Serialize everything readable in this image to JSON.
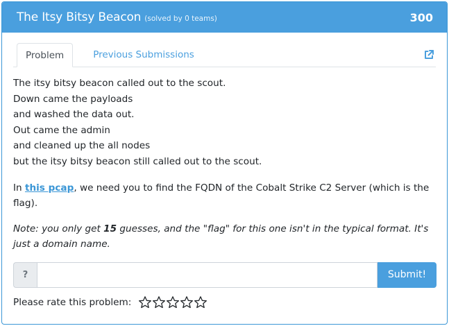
{
  "header": {
    "title": "The Itsy Bitsy Beacon",
    "solved": "(solved by 0 teams)",
    "points": "300"
  },
  "tabs": [
    {
      "label": "Problem",
      "active": true
    },
    {
      "label": "Previous Submissions",
      "active": false
    }
  ],
  "external_icon": "external-link-icon",
  "description": {
    "lines": [
      "The itsy bitsy beacon called out to the scout.",
      "Down came the payloads",
      "and washed the data out.",
      "Out came the admin",
      "and cleaned up the all nodes",
      "but the itsy bitsy beacon still called out to the scout."
    ],
    "paragraph_prefix": "In ",
    "link_text": "this pcap",
    "paragraph_suffix": ", we need you to find the FQDN of the Cobalt Strike C2 Server (which is the flag).",
    "note_prefix": "Note: you only get ",
    "note_count": "15",
    "note_suffix": " guesses, and the \"flag\" for this one isn't in the typical format. It's just a domain name."
  },
  "submission": {
    "prepend": "?",
    "value": "",
    "placeholder": "",
    "button_label": "Submit!"
  },
  "rating": {
    "label": "Please rate this problem:",
    "stars": 5,
    "selected": 0
  },
  "colors": {
    "accent": "#4a9fde",
    "link": "#3a96d6"
  }
}
